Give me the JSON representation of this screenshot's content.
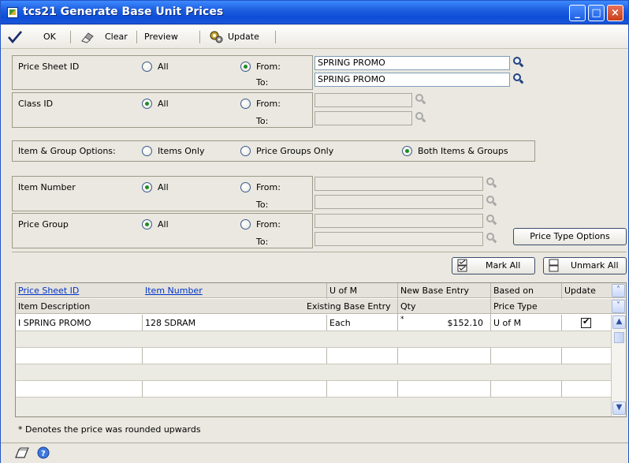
{
  "window": {
    "title": "tcs21 Generate Base Unit Prices"
  },
  "titlebar": {
    "min": "_",
    "max": "□",
    "close": "×"
  },
  "toolbar": {
    "ok": "OK",
    "clear": "Clear",
    "preview": "Preview",
    "update": "Update"
  },
  "price_sheet": {
    "label": "Price Sheet ID",
    "all": "All",
    "from": "From:",
    "to": "To:",
    "from_value": "SPRING PROMO",
    "to_value": "SPRING PROMO",
    "selected": "from"
  },
  "class_id": {
    "label": "Class ID",
    "all": "All",
    "from": "From:",
    "to": "To:",
    "from_value": "",
    "to_value": "",
    "selected": "all"
  },
  "item_group": {
    "label": "Item & Group Options:",
    "items_only": "Items Only",
    "price_groups_only": "Price Groups Only",
    "both": "Both Items & Groups",
    "selected": "both"
  },
  "item_number": {
    "label": "Item Number",
    "all": "All",
    "from": "From:",
    "to": "To:",
    "selected": "all"
  },
  "price_group": {
    "label": "Price Group",
    "all": "All",
    "from": "From:",
    "to": "To:",
    "selected": "all"
  },
  "buttons": {
    "price_type_options": "Price Type Options",
    "mark_all": "Mark All",
    "unmark_all": "Unmark All"
  },
  "grid": {
    "header1": {
      "price_sheet_id": "Price Sheet ID",
      "item_number": "Item Number",
      "uofm": "U of M",
      "new_base_entry": "New Base Entry",
      "based_on": "Based on",
      "update": "Update"
    },
    "header2": {
      "item_description": "Item Description",
      "existing_base_entry": "Existing Base Entry",
      "qty": "Qty",
      "price_type": "Price Type"
    },
    "rows": [
      {
        "sheet": "I SPRING PROMO",
        "item": "128 SDRAM",
        "uofm": "Each",
        "flag": "*",
        "price": "$152.10",
        "based_on": "U of M",
        "update": true
      }
    ]
  },
  "footer_note": "* Denotes the price was rounded upwards"
}
